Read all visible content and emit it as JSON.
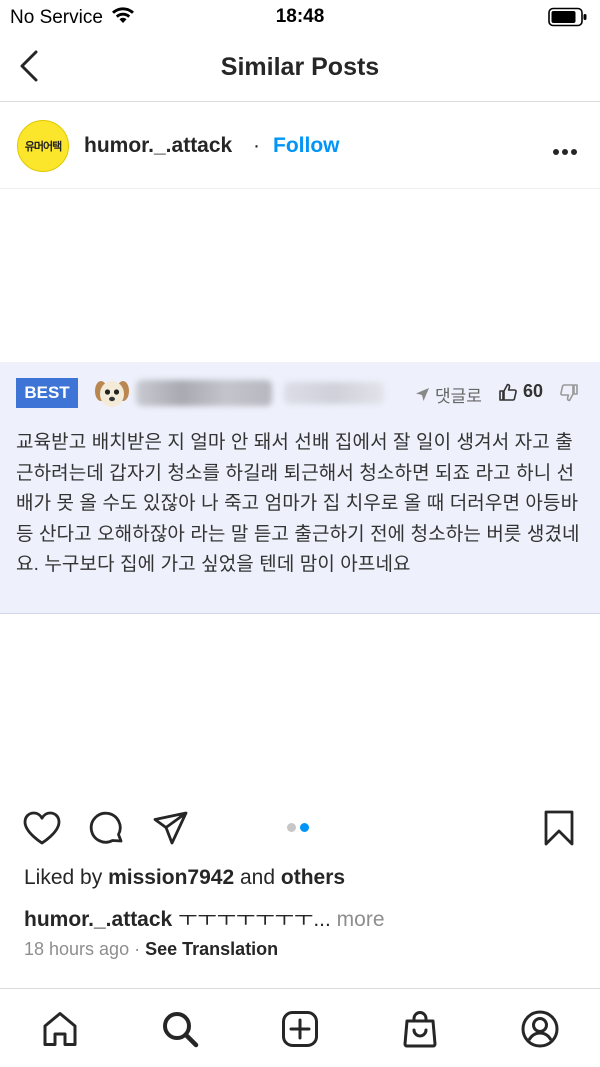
{
  "status_bar": {
    "carrier": "No Service",
    "time": "18:48"
  },
  "nav": {
    "title": "Similar Posts"
  },
  "post": {
    "avatar_text": "유머어택",
    "username": "humor._.attack",
    "separator": "·",
    "follow_label": "Follow"
  },
  "comment_card": {
    "badge": "BEST",
    "reply_label": "댓글로",
    "like_count": "60",
    "text": "교육받고 배치받은 지 얼마 안 돼서 선배 집에서 잘 일이 생겨서 자고 출근하려는데 갑자기 청소를 하길래 퇴근해서 청소하면 되죠 라고 하니 선배가 못 올 수도 있잖아 나 죽고 엄마가 집 치우로 올 때 더러우면 아등바등 산다고 오해하잖아 라는 말 듣고 출근하기 전에 청소하는 버릇 생겼네요. 누구보다 집에 가고 싶었을 텐데 맘이 아프네요"
  },
  "carousel": {
    "dot_colors": [
      "#c7c7c7",
      "#0095f6"
    ]
  },
  "likes": {
    "prefix": "Liked by",
    "user": "mission7942",
    "middle": "and",
    "others": "others"
  },
  "caption": {
    "username": "humor._.attack",
    "text": "ㅜㅜㅜㅜㅜㅜㅜ...",
    "more": "more"
  },
  "meta": {
    "time_ago": "18 hours ago",
    "dot": "·",
    "translate": "See Translation"
  },
  "colors": {
    "accent": "#0095f6",
    "badge": "#3d74d6",
    "card_bg": "#eef0fb"
  },
  "icons": [
    "wifi-icon",
    "battery-icon",
    "back-chevron-icon",
    "more-dots-icon",
    "send-arrow-icon",
    "thumbs-up-icon",
    "thumbs-down-icon",
    "heart-icon",
    "comment-icon",
    "share-icon",
    "bookmark-icon",
    "home-icon",
    "search-icon",
    "add-icon",
    "shop-icon",
    "profile-icon"
  ]
}
